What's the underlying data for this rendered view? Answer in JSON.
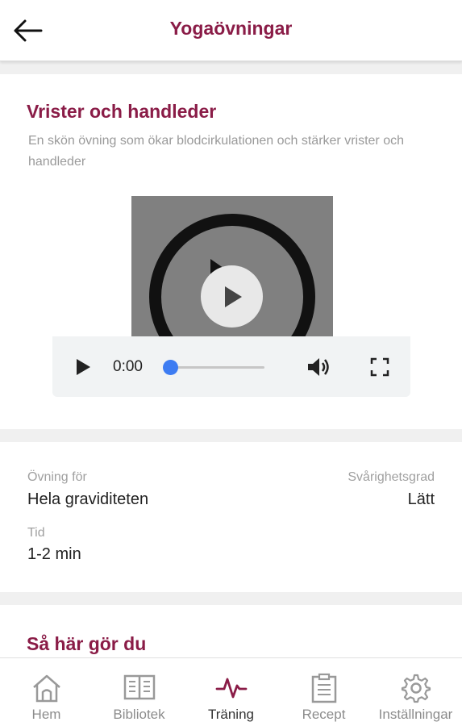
{
  "header": {
    "title": "Yogaövningar",
    "back_icon": "arrow-left-icon"
  },
  "exercise": {
    "title": "Vrister och handleder",
    "description": "En skön övning som ökar blodcirkulationen och stärker vrister och handleder"
  },
  "video": {
    "current_time": "0:00",
    "progress": 0,
    "icons": [
      "play-icon",
      "volume-icon",
      "fullscreen-icon"
    ],
    "accent": "#3d7cf2"
  },
  "info": {
    "for_label": "Övning för",
    "for_value": "Hela graviditeten",
    "difficulty_label": "Svårighetsgrad",
    "difficulty_value": "Lätt",
    "time_label": "Tid",
    "time_value": "1-2 min"
  },
  "howto": {
    "title": "Så här gör du"
  },
  "tabbar": {
    "items": [
      {
        "label": "Hem",
        "icon": "home-icon"
      },
      {
        "label": "Bibliotek",
        "icon": "book-icon"
      },
      {
        "label": "Träning",
        "icon": "activity-icon",
        "active": true
      },
      {
        "label": "Recept",
        "icon": "clipboard-icon"
      },
      {
        "label": "Inställningar",
        "icon": "gear-icon"
      }
    ]
  },
  "colors": {
    "brand": "#8a1c47",
    "muted": "#a0a0a0",
    "background": "#f0f0f0"
  }
}
